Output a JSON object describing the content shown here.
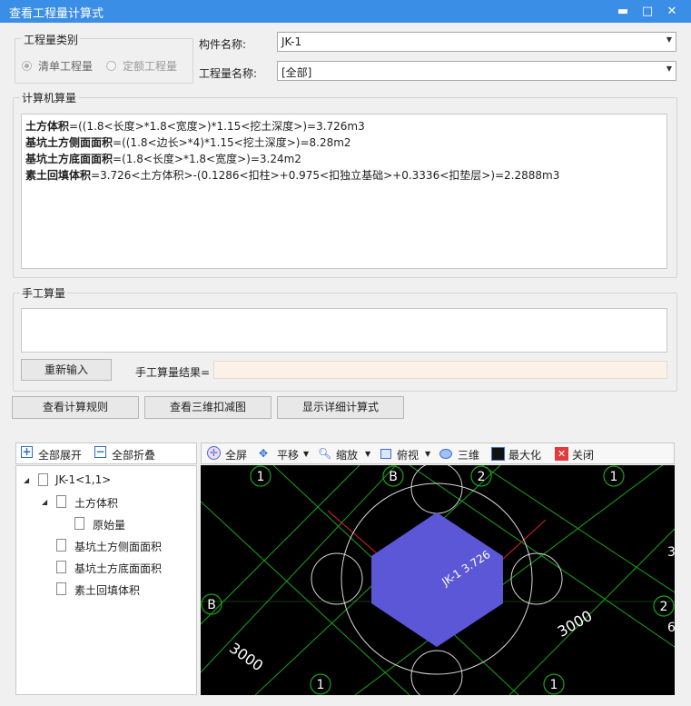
{
  "window": {
    "title": "查看工程量计算式",
    "minimize": "▬",
    "maximize": "□",
    "close": "✕"
  },
  "category": {
    "group_label": "工程量类别",
    "option1": "清单工程量",
    "option2": "定额工程量"
  },
  "component": {
    "label": "构件名称:",
    "value": "JK-1"
  },
  "quantity_name": {
    "label": "工程量名称:",
    "value": "[全部]"
  },
  "computer_calc": {
    "group_label": "计算机算量",
    "lines": [
      {
        "name": "土方体积",
        "expr": "=((1.8<长度>*1.8<宽度>)*1.15<挖土深度>)=3.726m3"
      },
      {
        "name": "基坑土方侧面面积",
        "expr": "=((1.8<边长>*4)*1.15<挖土深度>)=8.28m2"
      },
      {
        "name": "基坑土方底面面积",
        "expr": "=(1.8<长度>*1.8<宽度>)=3.24m2"
      },
      {
        "name": "素土回填体积",
        "expr": "=3.726<土方体积>-(0.1286<扣柱>+0.975<扣独立基础>+0.3336<扣垫层>)=2.2888m3"
      }
    ]
  },
  "manual_calc": {
    "group_label": "手工算量",
    "reinput_button": "重新输入",
    "result_label": "手工算量结果="
  },
  "buttons": {
    "view_rules": "查看计算规则",
    "view_3d": "查看三维扣减图",
    "show_detail": "显示详细计算式"
  },
  "tree_toolbar": {
    "expand_all": "全部展开",
    "collapse_all": "全部折叠"
  },
  "tree": {
    "root": "JK-1<1,1>",
    "n1": "土方体积",
    "n1_child": "原始量",
    "n2": "基坑土方侧面面积",
    "n3": "基坑土方底面面积",
    "n4": "素土回填体积"
  },
  "view_toolbar": {
    "fullscreen": "全屏",
    "pan": "平移",
    "zoom": "缩放",
    "view": "俯视",
    "three_d": "三维",
    "maximize": "最大化",
    "close": "关闭"
  },
  "drawing": {
    "axis_1a": "1",
    "axis_b_top": "B",
    "axis_2_top": "2",
    "axis_1_top_right": "1",
    "axis_b_left": "B",
    "axis_2_right": "2",
    "axis_1_bottom_left": "1",
    "axis_1_bottom_right": "1",
    "dim_left": "3000",
    "dim_right": "3000",
    "label": "JK-1 3.726",
    "edge_3": "3",
    "edge_6": "6",
    "colors": {
      "box": "#5b57d6",
      "grid": "#1aa31a",
      "red": "#e02020",
      "circle": "#d8d8d8"
    }
  }
}
